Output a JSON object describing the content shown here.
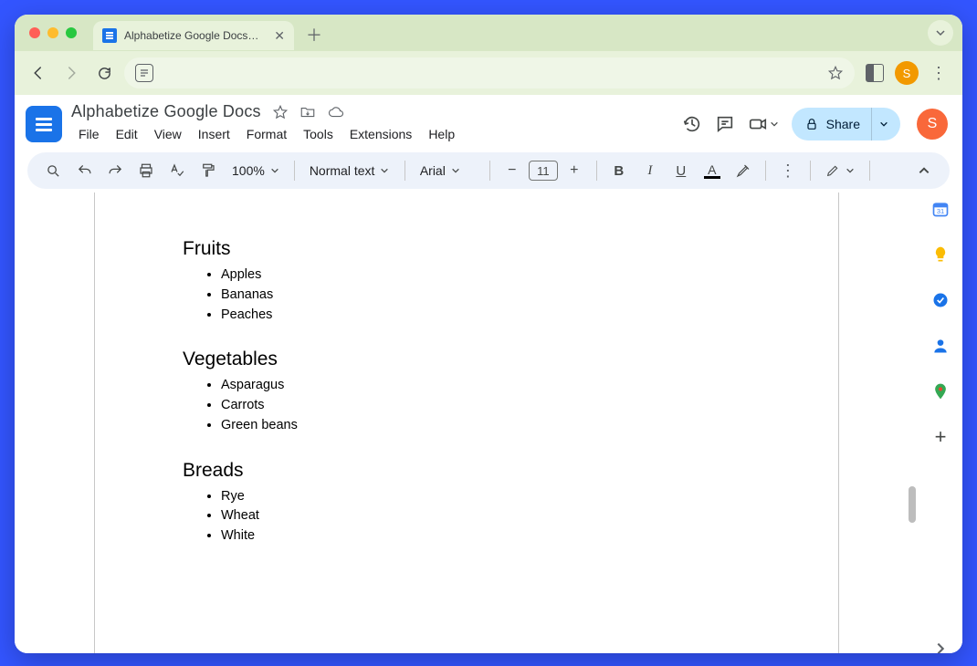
{
  "browser": {
    "tab_title": "Alphabetize Google Docs - G",
    "avatar_letter": "S"
  },
  "docs": {
    "title": "Alphabetize Google Docs",
    "menus": [
      "File",
      "Edit",
      "View",
      "Insert",
      "Format",
      "Tools",
      "Extensions",
      "Help"
    ],
    "share_label": "Share",
    "avatar_letter": "S"
  },
  "toolbar": {
    "zoom": "100%",
    "style": "Normal text",
    "font": "Arial",
    "fontsize": "11"
  },
  "document": {
    "sections": [
      {
        "heading": "Fruits",
        "items": [
          "Apples",
          "Bananas",
          "Peaches"
        ]
      },
      {
        "heading": "Vegetables",
        "items": [
          "Asparagus",
          "Carrots",
          "Green beans"
        ]
      },
      {
        "heading": "Breads",
        "items": [
          "Rye",
          "Wheat",
          "White"
        ]
      }
    ]
  },
  "sidepanel": {
    "items": [
      "calendar-icon",
      "keep-icon",
      "tasks-icon",
      "contacts-icon",
      "maps-icon"
    ]
  }
}
